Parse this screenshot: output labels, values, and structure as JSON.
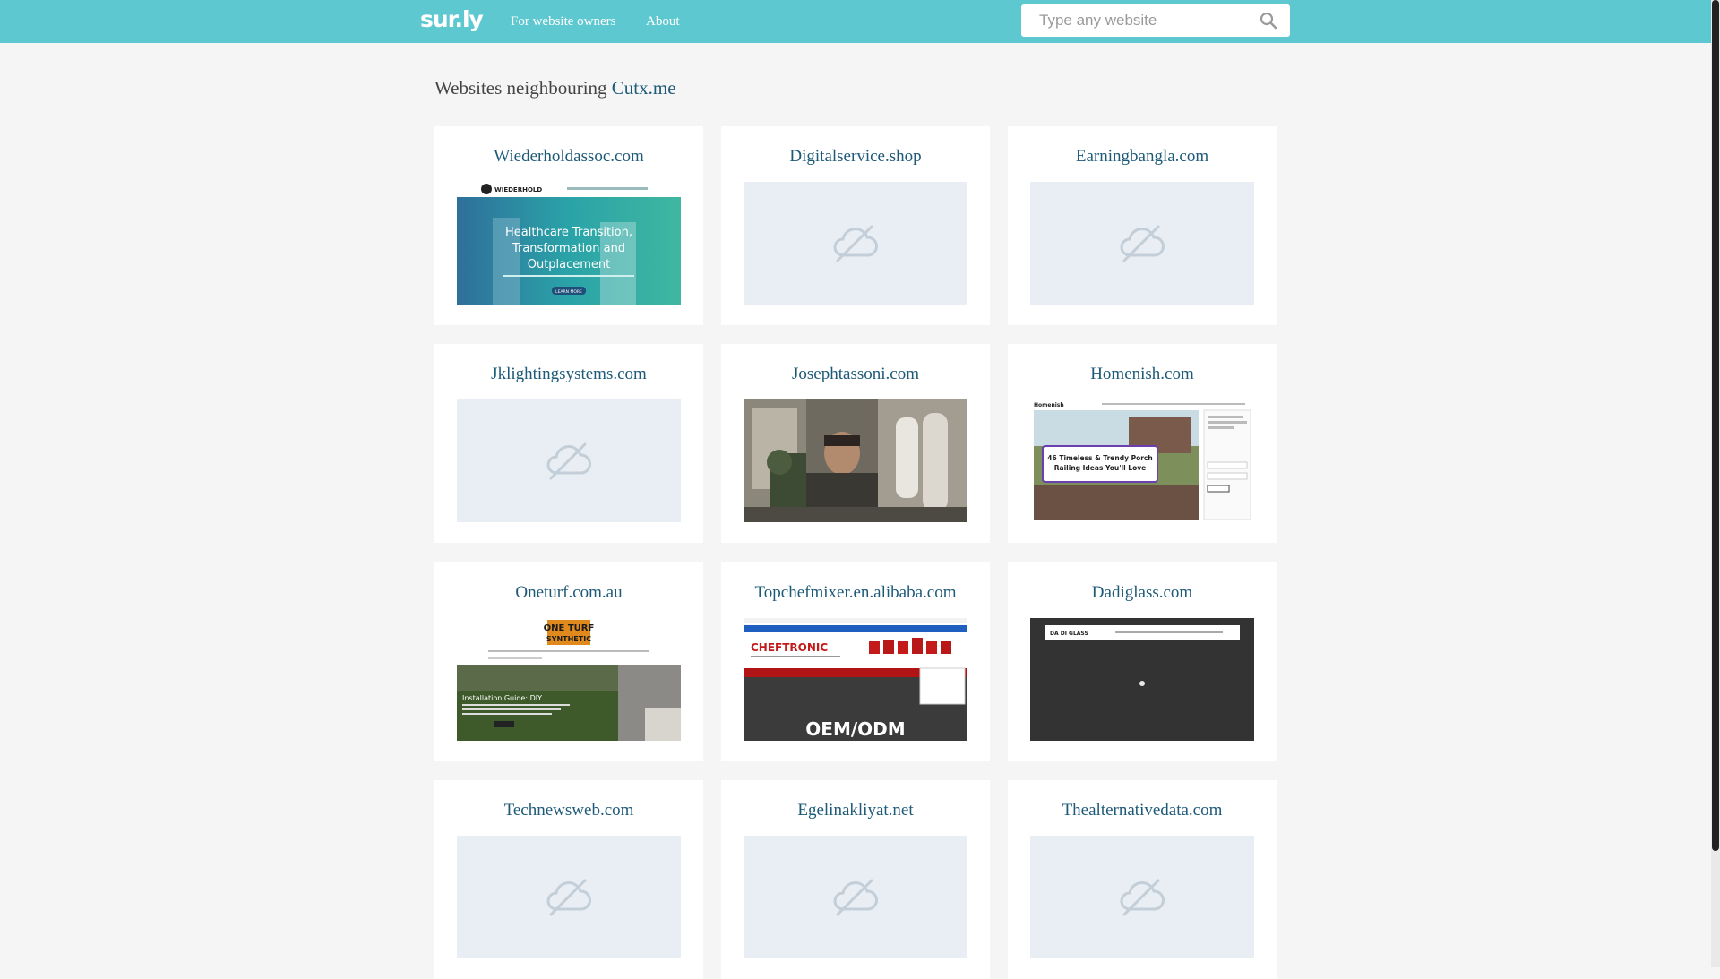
{
  "header": {
    "logo_text": "sur",
    "logo_dot": ".",
    "logo_end": "ly",
    "nav": [
      "For website owners",
      "About"
    ],
    "search_placeholder": "Type any website"
  },
  "heading": {
    "prefix": "Websites neighbouring ",
    "site": "Cutx.me"
  },
  "cards": [
    {
      "title": "Wiederholdassoc.com",
      "thumb": "healthcare"
    },
    {
      "title": "Digitalservice.shop",
      "thumb": "placeholder"
    },
    {
      "title": "Earningbangla.com",
      "thumb": "placeholder"
    },
    {
      "title": "Jklightingsystems.com",
      "thumb": "placeholder"
    },
    {
      "title": "Josephtassoni.com",
      "thumb": "photo"
    },
    {
      "title": "Homenish.com",
      "thumb": "homenish"
    },
    {
      "title": "Oneturf.com.au",
      "thumb": "oneturf"
    },
    {
      "title": "Topchefmixer.en.alibaba.com",
      "thumb": "alibaba"
    },
    {
      "title": "Dadiglass.com",
      "thumb": "dark"
    },
    {
      "title": "Technewsweb.com",
      "thumb": "placeholder"
    },
    {
      "title": "Egelinakliyat.net",
      "thumb": "placeholder"
    },
    {
      "title": "Thealternativedata.com",
      "thumb": "placeholder"
    }
  ],
  "thumb_text": {
    "healthcare": [
      "WIEDERHOLD",
      "Healthcare Transition,",
      "Transformation and",
      "Outplacement",
      "LEARN MORE"
    ],
    "homenish": [
      "Homenish",
      "46 Timeless & Trendy Porch",
      "Railing Ideas You'll Love"
    ],
    "oneturf": [
      "ONE TURF",
      "SYNTHETIC",
      "Installation Guide: DIY"
    ],
    "alibaba": [
      "CHEFTRONIC",
      "OEM/ODM"
    ],
    "dark": [
      "DA DI GLASS"
    ]
  },
  "colors": {
    "header_bg": "#5ec8d0",
    "link": "#1d5a78",
    "card_bg": "#ffffff",
    "page_bg": "#f5f5f5",
    "placeholder_bg": "#e8eef3"
  }
}
